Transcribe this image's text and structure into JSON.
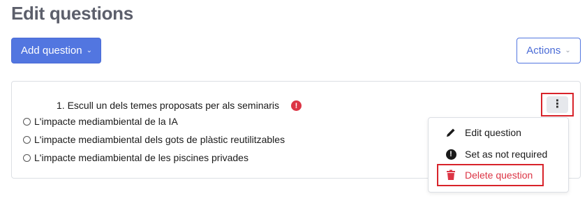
{
  "page": {
    "title": "Edit questions"
  },
  "toolbar": {
    "add_question_label": "Add question",
    "actions_label": "Actions"
  },
  "question": {
    "text": "1. Escull un dels temes proposats per als seminaris",
    "required_badge": "!",
    "options": [
      "L'impacte mediambiental de la IA",
      "L'impacte mediambiental dels gots de plàstic reutilitzables",
      "L'impacte mediambiental de les piscines privades"
    ]
  },
  "question_menu": {
    "kebab_icon": "more-vertical-icon",
    "items": [
      {
        "label": "Edit question",
        "icon": "pencil-icon"
      },
      {
        "label": "Set as not required",
        "icon": "exclamation-circle-icon"
      },
      {
        "label": "Delete question",
        "icon": "trash-icon"
      }
    ]
  },
  "colors": {
    "primary": "#5276e0",
    "danger": "#dc3545",
    "highlight": "#d8232a"
  }
}
